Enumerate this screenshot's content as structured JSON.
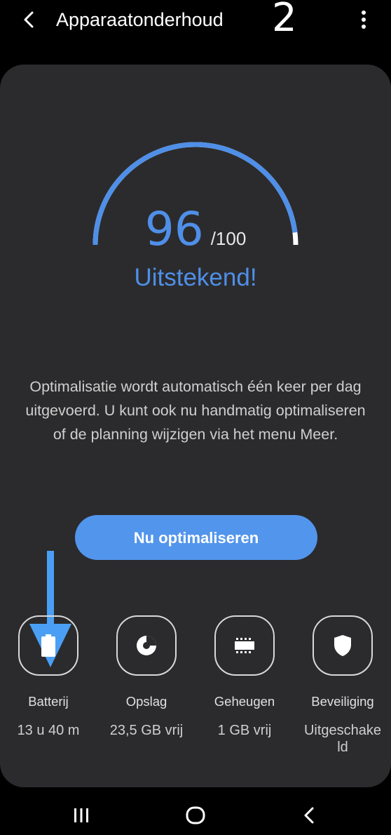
{
  "header": {
    "title": "Apparaatonderhoud",
    "step_number": "2",
    "back_icon": "chevron-left-icon",
    "more_icon": "more-vertical-icon"
  },
  "score": {
    "value": "96",
    "max": "/100",
    "fraction": 0.96,
    "status": "Uitstekend!"
  },
  "description": "Optimalisatie wordt automatisch één keer per dag uitgevoerd. U kunt ook nu handmatig optimaliseren of de planning wijzigen via het menu Meer.",
  "optimize_button": {
    "label": "Nu optimaliseren"
  },
  "tiles": [
    {
      "label": "Batterij",
      "value": "13 u 40 m",
      "icon": "battery-icon"
    },
    {
      "label": "Opslag",
      "value": "23,5 GB vrij",
      "icon": "storage-pie-icon"
    },
    {
      "label": "Geheugen",
      "value": "1 GB vrij",
      "icon": "memory-chip-icon"
    },
    {
      "label": "Beveiliging",
      "value": "Uitgeschake\nld",
      "icon": "shield-icon"
    }
  ],
  "colors": {
    "accent": "#5295ec",
    "score_text": "#4f8fe8",
    "card_background": "#2b2b2d",
    "arrow": "#4a9ff5"
  },
  "navbar": {
    "icons": [
      "recent-apps-icon",
      "home-icon",
      "back-nav-icon"
    ]
  }
}
